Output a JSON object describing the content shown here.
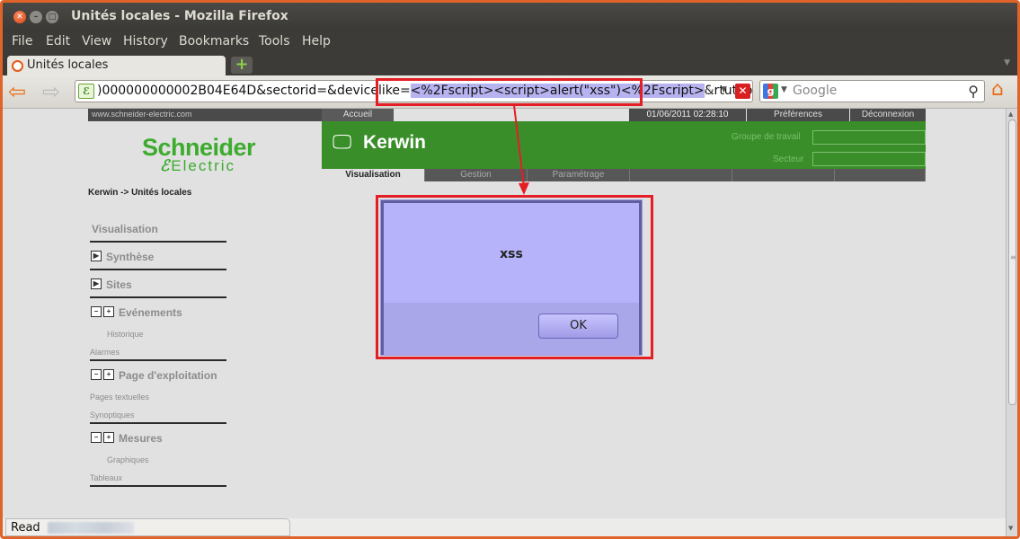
{
  "window": {
    "title": "Unités locales - Mozilla Firefox"
  },
  "menubar": [
    "File",
    "Edit",
    "View",
    "History",
    "Bookmarks",
    "Tools",
    "Help"
  ],
  "tab": {
    "title": "Unités locales"
  },
  "urlbar": {
    "prefix": ")000000000002B04E64D&sectorid=&devicelike=",
    "selected": "<%2Fscript><script>alert(\"xss\")<%2Fscript>",
    "suffix": "&rtutype="
  },
  "search": {
    "placeholder": "Google"
  },
  "site": {
    "domain": "www.schneider-electric.com",
    "logo_top": "Schneider",
    "logo_bottom": "Electric",
    "nav": {
      "home": "Accueil",
      "datetime": "01/06/2011 02:28:10",
      "preferences": "Préférences",
      "logout": "Déconnexion"
    },
    "app_name": "Kerwin",
    "workgroup_label": "Groupe de travail",
    "sector_label": "Secteur",
    "tabs": [
      "Visualisation",
      "Gestion",
      "Paramétrage",
      "",
      "",
      ""
    ],
    "breadcrumb": "Kerwin -> Unités locales"
  },
  "sidebar": {
    "visualisation": "Visualisation",
    "synthese": "Synthèse",
    "sites": "Sites",
    "evenements": "Evénements",
    "historique": "Historique",
    "alarmes": "Alarmes",
    "page_exploitation": "Page d'exploitation",
    "pages_textuelles": "Pages textuelles",
    "synoptiques": "Synoptiques",
    "mesures": "Mesures",
    "graphiques": "Graphiques",
    "tableaux": "Tableaux"
  },
  "dialog": {
    "message": "xss",
    "ok": "OK"
  },
  "status": {
    "text": "Read"
  },
  "colors": {
    "accent": "#e31e24",
    "brand_green": "#3a8e2a",
    "dialog_bg": "#b7b3fb",
    "frame": "#e0642a"
  }
}
